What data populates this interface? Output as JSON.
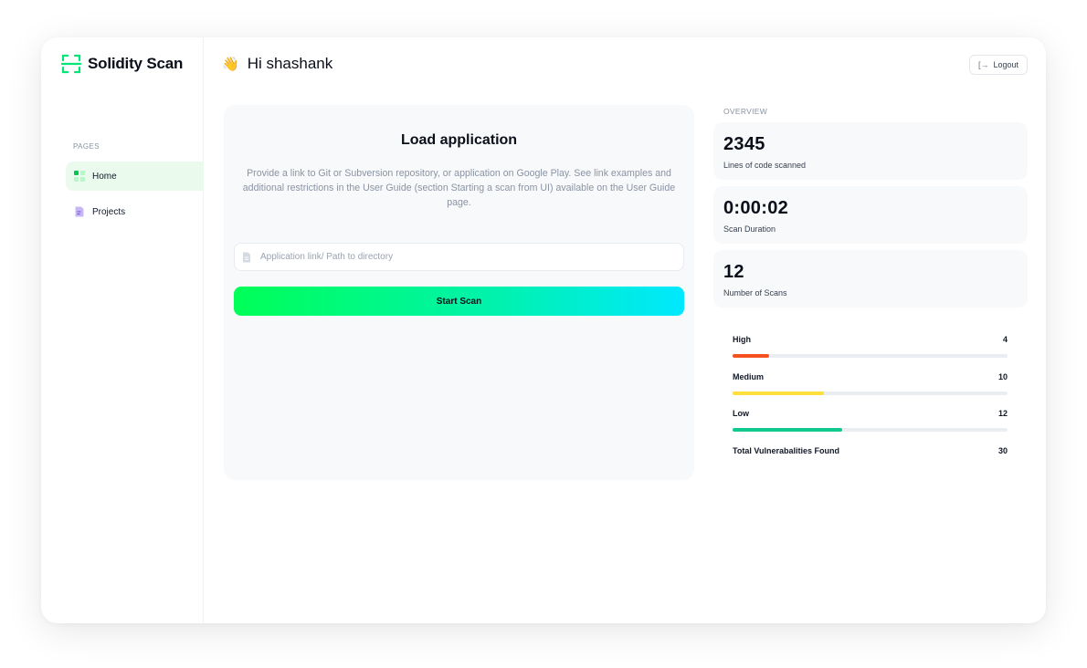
{
  "brand": {
    "name": "Solidity Scan",
    "icon": "scan-frame-icon",
    "accent": "#00e676"
  },
  "sidebar": {
    "section_label": "PAGES",
    "items": [
      {
        "label": "Home",
        "icon": "grid-icon",
        "active": true
      },
      {
        "label": "Projects",
        "icon": "document-icon",
        "active": false
      }
    ]
  },
  "header": {
    "wave_emoji": "👋",
    "greeting": "Hi shashank",
    "logout_label": "Logout",
    "logout_icon": "logout-icon"
  },
  "load": {
    "title": "Load application",
    "description": "Provide a link to Git or Subversion repository, or application on Google Play. See link examples and additional restrictions in the User Guide (section Starting a scan from UI) available on the User Guide page.",
    "input_placeholder": "Application link/ Path to directory",
    "input_value": "",
    "start_label": "Start Scan"
  },
  "overview": {
    "label": "OVERVIEW",
    "stats": [
      {
        "value": "2345",
        "label": "Lines of code scanned"
      },
      {
        "value": "0:00:02",
        "label": "Scan Duration"
      },
      {
        "value": "12",
        "label": "Number of Scans"
      }
    ]
  },
  "vulnerabilities": {
    "items": [
      {
        "label": "High",
        "count": "4",
        "fraction": 0.133,
        "color": "#f4511e"
      },
      {
        "label": "Medium",
        "count": "10",
        "fraction": 0.333,
        "color": "#ffe03d"
      },
      {
        "label": "Low",
        "count": "12",
        "fraction": 0.4,
        "color": "#10c98f"
      }
    ],
    "total_label": "Total Vulnerabalities Found",
    "total_count": "30"
  }
}
